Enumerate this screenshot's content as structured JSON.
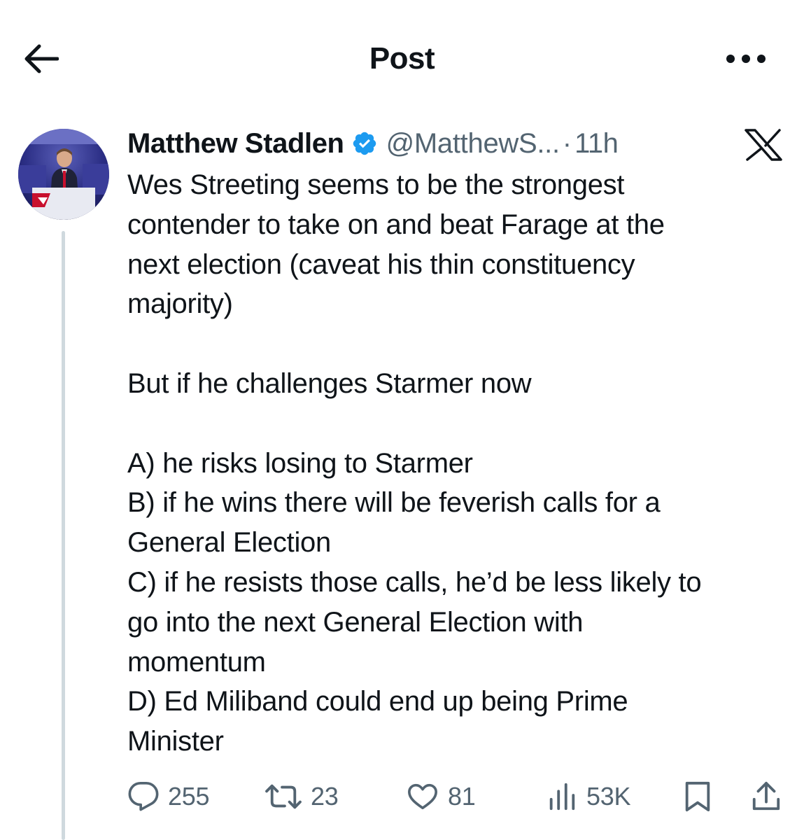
{
  "header": {
    "title": "Post"
  },
  "author": {
    "name": "Matthew Stadlen",
    "handle": "@MatthewS...",
    "dot": "·",
    "time": "11h"
  },
  "post": {
    "paragraphs": [
      [
        "Wes Streeting seems to be the strongest",
        "contender to take on and beat Farage at the",
        "next election (caveat his thin constituency",
        "majority)"
      ],
      [
        "But if he challenges Starmer now"
      ],
      [
        "A) he risks losing to Starmer",
        "B) if he wins there will be feverish calls for a",
        "General Election",
        "C) if he resists those calls, he’d be less likely to",
        "go into the next General Election with",
        "momentum",
        "D) Ed Miliband could end up being Prime",
        "Minister"
      ]
    ]
  },
  "actions": {
    "replies": "255",
    "reposts": "23",
    "likes": "81",
    "views": "53K"
  },
  "colors": {
    "text_primary": "#0f1419",
    "text_secondary": "#536471",
    "verified_blue": "#1d9bf0",
    "thread_line": "#cfd9de"
  },
  "icons": {
    "back": "arrow-left-icon",
    "more": "more-horizontal-icon",
    "verified": "verified-badge-icon",
    "platform": "x-logo-icon",
    "reply": "reply-icon",
    "repost": "repost-icon",
    "like": "heart-icon",
    "views": "views-chart-icon",
    "bookmark": "bookmark-icon",
    "share": "share-icon"
  }
}
